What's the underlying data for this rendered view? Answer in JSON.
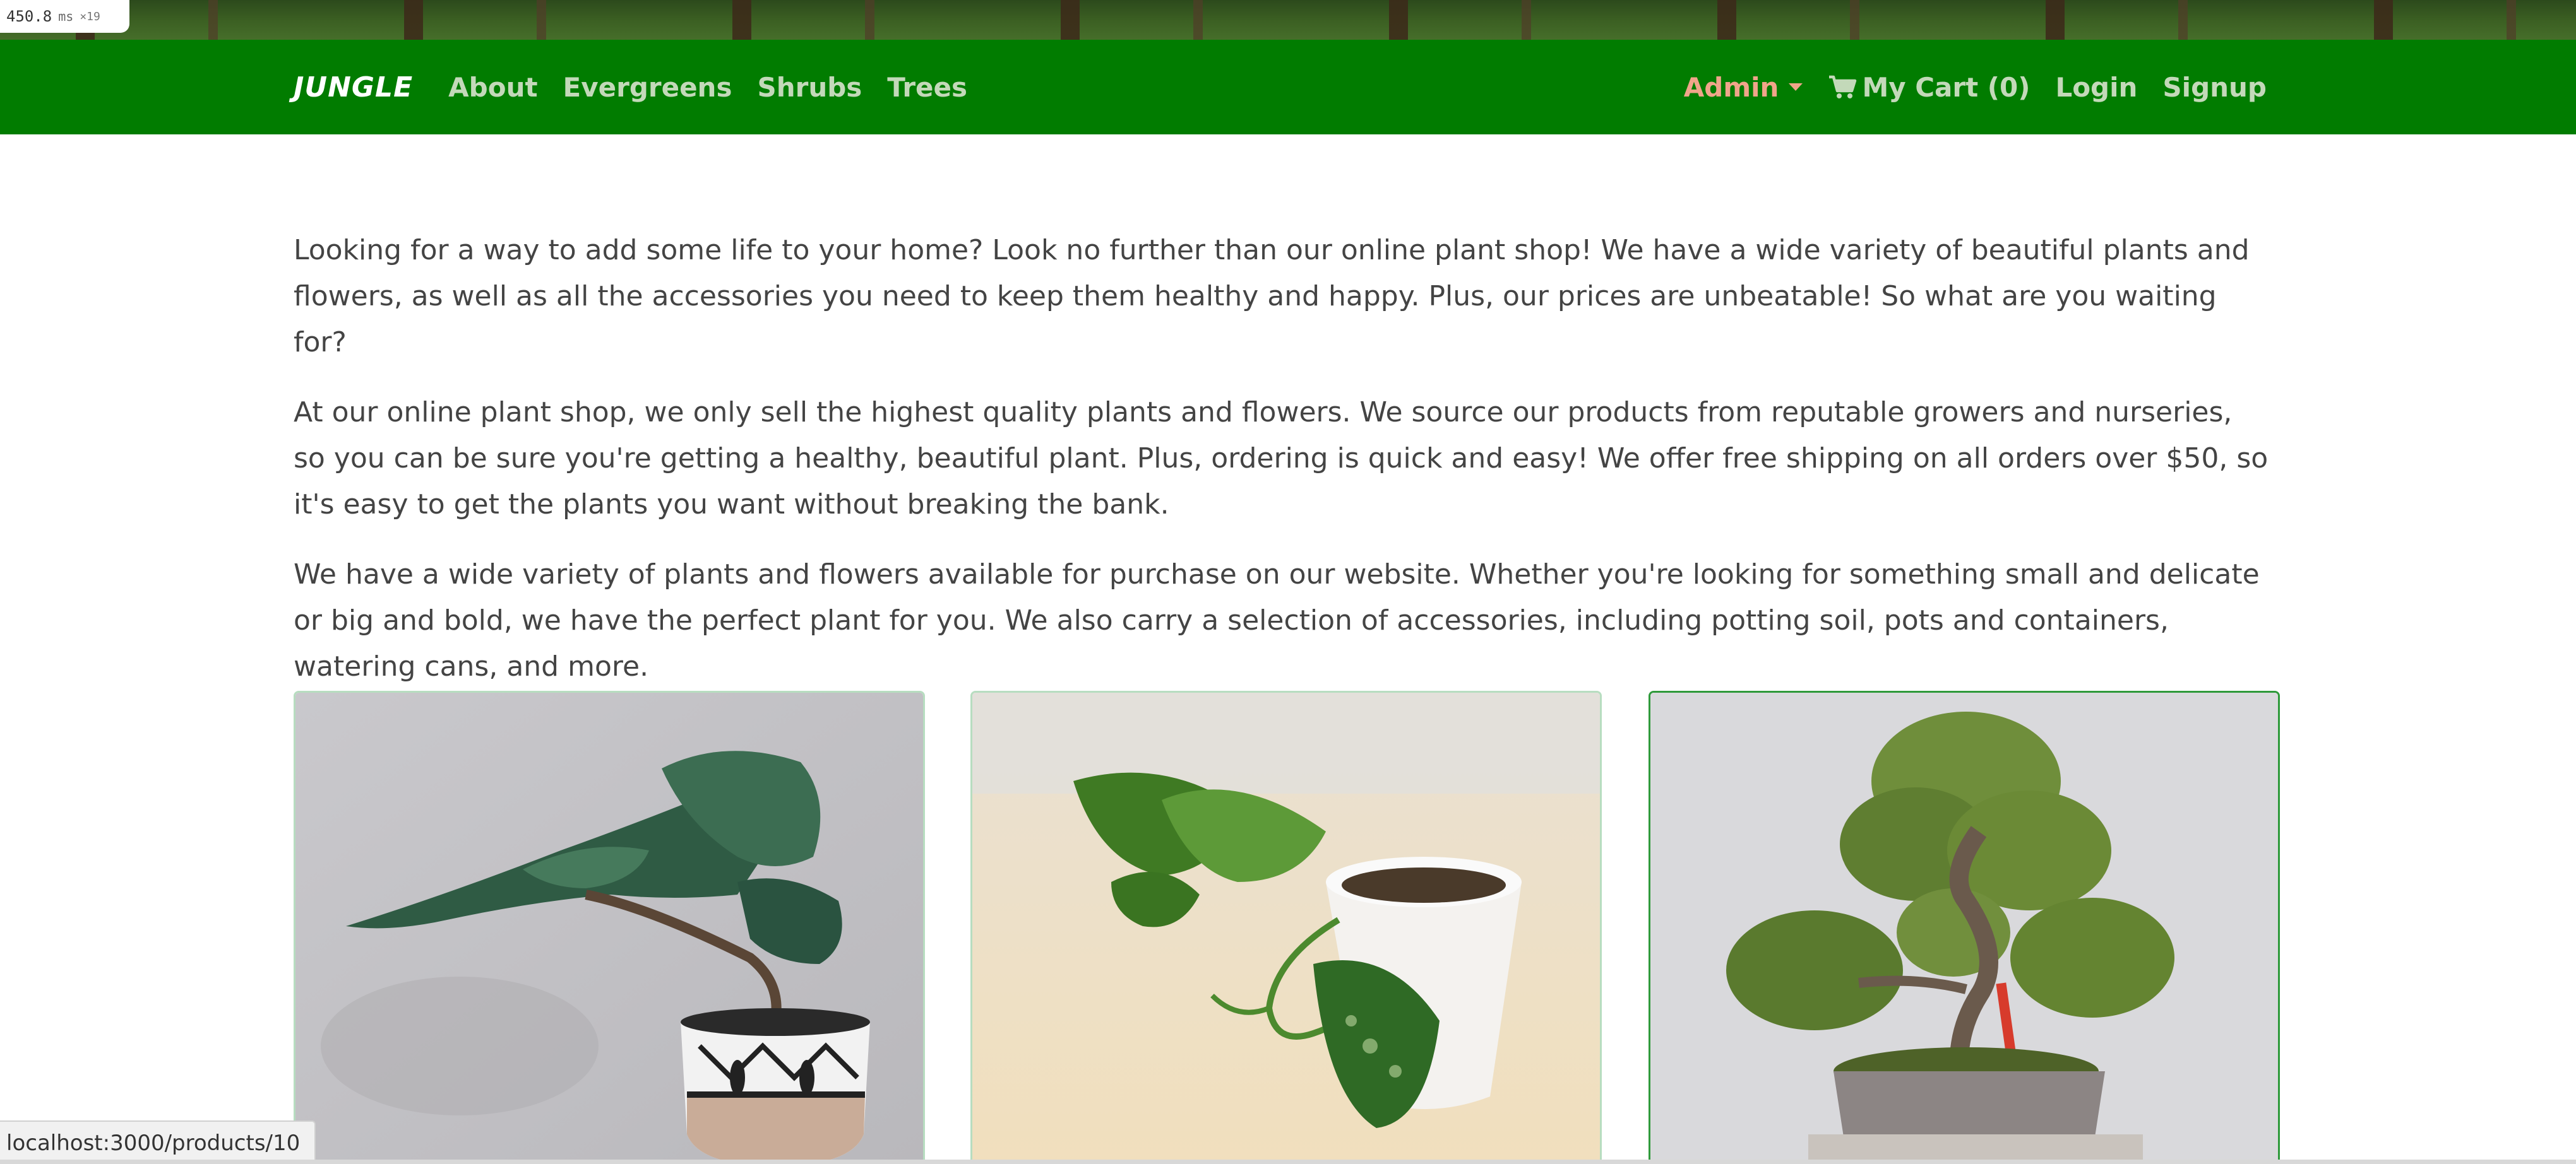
{
  "perf_badge": {
    "value": "450.8",
    "unit": "ms",
    "count": "×19"
  },
  "navbar": {
    "brand": "JUNGLE",
    "links": [
      "About",
      "Evergreens",
      "Shrubs",
      "Trees"
    ],
    "admin_label": "Admin",
    "cart_label": "My Cart (0)",
    "login_label": "Login",
    "signup_label": "Signup",
    "bg_color": "#017c00",
    "link_color": "#c3d9b9",
    "admin_color": "#f0a58a"
  },
  "intro": {
    "paragraphs": [
      "Looking for a way to add some life to your home? Look no further than our online plant shop! We have a wide variety of beautiful plants and flowers, as well as all the accessories you need to keep them healthy and happy. Plus, our prices are unbeatable! So what are you waiting for?",
      "At our online plant shop, we only sell the highest quality plants and flowers. We source our products from reputable growers and nurseries, so you can be sure you're getting a healthy, beautiful plant. Plus, ordering is quick and easy! We offer free shipping on all orders over $50, so it's easy to get the plants you want without breaking the bank.",
      "We have a wide variety of plants and flowers available for purchase on our website. Whether you're looking for something small and delicate or big and bold, we have the perfect plant for you. We also carry a selection of accessories, including potting soil, pots and containers, watering cans, and more."
    ]
  },
  "products": [
    {
      "image": "juniper-bonsai-in-patterned-pot"
    },
    {
      "image": "pothos-cutting-in-white-pot"
    },
    {
      "image": "bonsai-tree-in-grey-pot"
    }
  ],
  "status_bar": {
    "url": "localhost:3000/products/10"
  }
}
